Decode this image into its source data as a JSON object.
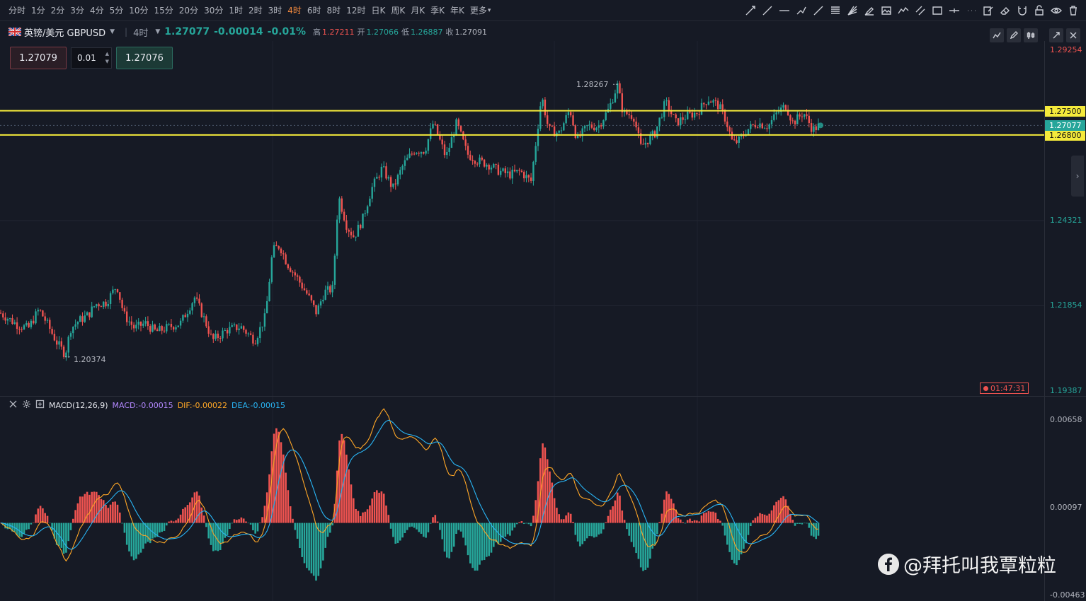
{
  "timeframes": [
    "分时",
    "1分",
    "2分",
    "3分",
    "4分",
    "5分",
    "10分",
    "15分",
    "20分",
    "30分",
    "1时",
    "2时",
    "3时",
    "4时",
    "6时",
    "8时",
    "12时",
    "日K",
    "周K",
    "月K",
    "季K",
    "年K",
    "更多"
  ],
  "active_timeframe": "4时",
  "drawing_tools": [
    "trend-line-icon",
    "ray-icon",
    "horizontal-line-icon",
    "polyline-icon",
    "arrow-line-icon",
    "fibonacci-icon",
    "fan-icon",
    "brush-icon",
    "image-icon",
    "chart-line-icon",
    "parallel-channel-icon",
    "rectangle-icon",
    "horizontal-ray-icon",
    "more-dots-icon",
    "edit-icon",
    "eraser-icon",
    "magnet-icon",
    "lock-icon",
    "eye-icon",
    "trash-icon"
  ],
  "symbol": {
    "name": "英镑/美元 GBPUSD",
    "period": "4时",
    "last_price": "1.27077",
    "change": "-0.00014",
    "change_pct": "-0.01%",
    "high_label": "高",
    "high": "1.27211",
    "open_label": "开",
    "open": "1.27066",
    "low_label": "低",
    "low": "1.26887",
    "close_label": "收",
    "close": "1.27091"
  },
  "order": {
    "sell_price": "1.27079",
    "quantity": "0.01",
    "buy_price": "1.27076"
  },
  "price_axis": {
    "labels": [
      "1.29254",
      "1.24321",
      "1.21854",
      "1.19387"
    ],
    "lines": [
      {
        "label": "1.27500",
        "color": "#f5ea3b"
      },
      {
        "label": "1.26800",
        "color": "#f5ea3b"
      }
    ],
    "current_price_tag": "1.27077",
    "countdown": "01:47:31"
  },
  "annotations": {
    "high_marker": "1.28267",
    "low_marker": "1.20374"
  },
  "macd": {
    "name": "MACD(12,26,9)",
    "macd_value": "MACD:-0.00015",
    "dif_value": "DIF:-0.00022",
    "dea_value": "DEA:-0.00015",
    "axis_labels": [
      "0.00658",
      "0.00097",
      "-0.00463"
    ],
    "colors": {
      "positive": "#ef5350",
      "negative": "#26a69a",
      "dif": "#ffa726",
      "dea": "#29b6f6"
    }
  },
  "colors": {
    "up": "#26a69a",
    "down": "#ef5350",
    "background": "#161a25",
    "level_line": "#f5ea3b"
  },
  "watermark": "@拜托叫我覃粒粒",
  "chart_data": {
    "type": "candlestick",
    "symbol": "GBPUSD",
    "timeframe": "4时",
    "y_axis_labels": [
      1.29254,
      1.24321,
      1.21854,
      1.19387
    ],
    "ylim": [
      1.19387,
      1.29254
    ],
    "horizontal_levels": [
      1.275,
      1.268
    ],
    "marked_high": 1.28267,
    "marked_low": 1.20374,
    "current_price": 1.27077,
    "close_path_anchors": [
      [
        0,
        1.2165
      ],
      [
        25,
        1.213
      ],
      [
        40,
        1.212
      ],
      [
        55,
        1.2175
      ],
      [
        65,
        1.214
      ],
      [
        80,
        1.208
      ],
      [
        92,
        1.2045
      ],
      [
        100,
        1.212
      ],
      [
        110,
        1.214
      ],
      [
        125,
        1.216
      ],
      [
        135,
        1.219
      ],
      [
        150,
        1.2195
      ],
      [
        165,
        1.2245
      ],
      [
        175,
        1.216
      ],
      [
        190,
        1.212
      ],
      [
        205,
        1.2135
      ],
      [
        220,
        1.211
      ],
      [
        240,
        1.2125
      ],
      [
        255,
        1.2135
      ],
      [
        275,
        1.221
      ],
      [
        290,
        1.214
      ],
      [
        300,
        1.2085
      ],
      [
        320,
        1.2115
      ],
      [
        340,
        1.2125
      ],
      [
        360,
        1.2085
      ],
      [
        375,
        1.2155
      ],
      [
        385,
        1.2345
      ],
      [
        395,
        1.236
      ],
      [
        405,
        1.231
      ],
      [
        420,
        1.2265
      ],
      [
        435,
        1.2215
      ],
      [
        447,
        1.2165
      ],
      [
        458,
        1.2225
      ],
      [
        470,
        1.2235
      ],
      [
        478,
        1.2505
      ],
      [
        490,
        1.2415
      ],
      [
        500,
        1.2385
      ],
      [
        512,
        1.2435
      ],
      [
        525,
        1.2525
      ],
      [
        540,
        1.2585
      ],
      [
        555,
        1.2525
      ],
      [
        570,
        1.2595
      ],
      [
        585,
        1.2635
      ],
      [
        600,
        1.2635
      ],
      [
        612,
        1.2715
      ],
      [
        630,
        1.2615
      ],
      [
        645,
        1.2715
      ],
      [
        660,
        1.2625
      ],
      [
        675,
        1.2605
      ],
      [
        690,
        1.2595
      ],
      [
        705,
        1.2575
      ],
      [
        720,
        1.2565
      ],
      [
        735,
        1.2575
      ],
      [
        750,
        1.2545
      ],
      [
        758,
        1.2675
      ],
      [
        765,
        1.2795
      ],
      [
        775,
        1.2695
      ],
      [
        790,
        1.2685
      ],
      [
        805,
        1.2755
      ],
      [
        815,
        1.2665
      ],
      [
        830,
        1.2705
      ],
      [
        845,
        1.2705
      ],
      [
        860,
        1.2755
      ],
      [
        872,
        1.2825
      ],
      [
        880,
        1.2745
      ],
      [
        895,
        1.2735
      ],
      [
        905,
        1.2645
      ],
      [
        915,
        1.2665
      ],
      [
        925,
        1.2685
      ],
      [
        940,
        1.2775
      ],
      [
        955,
        1.2715
      ],
      [
        970,
        1.2735
      ],
      [
        985,
        1.2745
      ],
      [
        1000,
        1.2785
      ],
      [
        1015,
        1.2765
      ],
      [
        1025,
        1.2725
      ],
      [
        1035,
        1.2655
      ],
      [
        1045,
        1.2665
      ],
      [
        1055,
        1.2695
      ],
      [
        1070,
        1.2715
      ],
      [
        1085,
        1.2705
      ],
      [
        1098,
        1.2745
      ],
      [
        1110,
        1.2765
      ],
      [
        1120,
        1.2715
      ],
      [
        1135,
        1.2745
      ],
      [
        1148,
        1.2695
      ],
      [
        1158,
        1.2708
      ]
    ]
  }
}
